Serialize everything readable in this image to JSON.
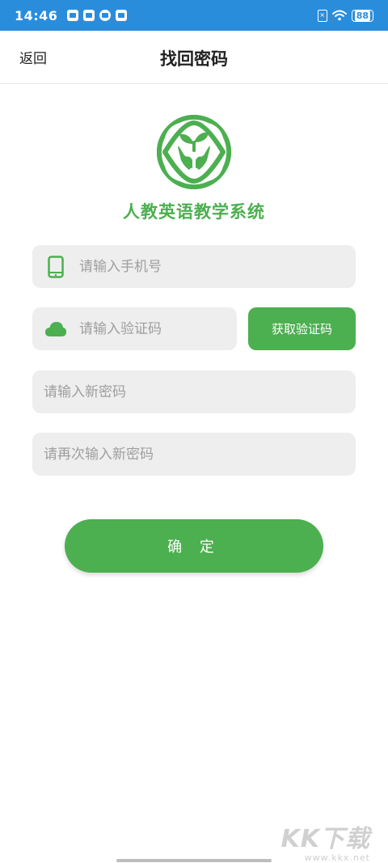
{
  "status_bar": {
    "time": "14:46",
    "battery": "88"
  },
  "header": {
    "back_label": "返回",
    "title": "找回密码"
  },
  "app": {
    "name": "人教英语教学系统"
  },
  "form": {
    "phone_placeholder": "请输入手机号",
    "code_placeholder": "请输入验证码",
    "get_code_label": "获取验证码",
    "new_password_placeholder": "请输入新密码",
    "confirm_password_placeholder": "请再次输入新密码",
    "submit_label": "确 定"
  },
  "watermark": {
    "logo": "KK下载",
    "url": "www.kkx.net"
  },
  "colors": {
    "status_bar": "#2a8ddc",
    "accent": "#4caf50",
    "field_bg": "#eeeeee",
    "placeholder": "#9e9e9e"
  },
  "icons": {
    "phone": "phone-icon",
    "code": "cloud-icon",
    "logo": "sprout-hands-icon"
  }
}
